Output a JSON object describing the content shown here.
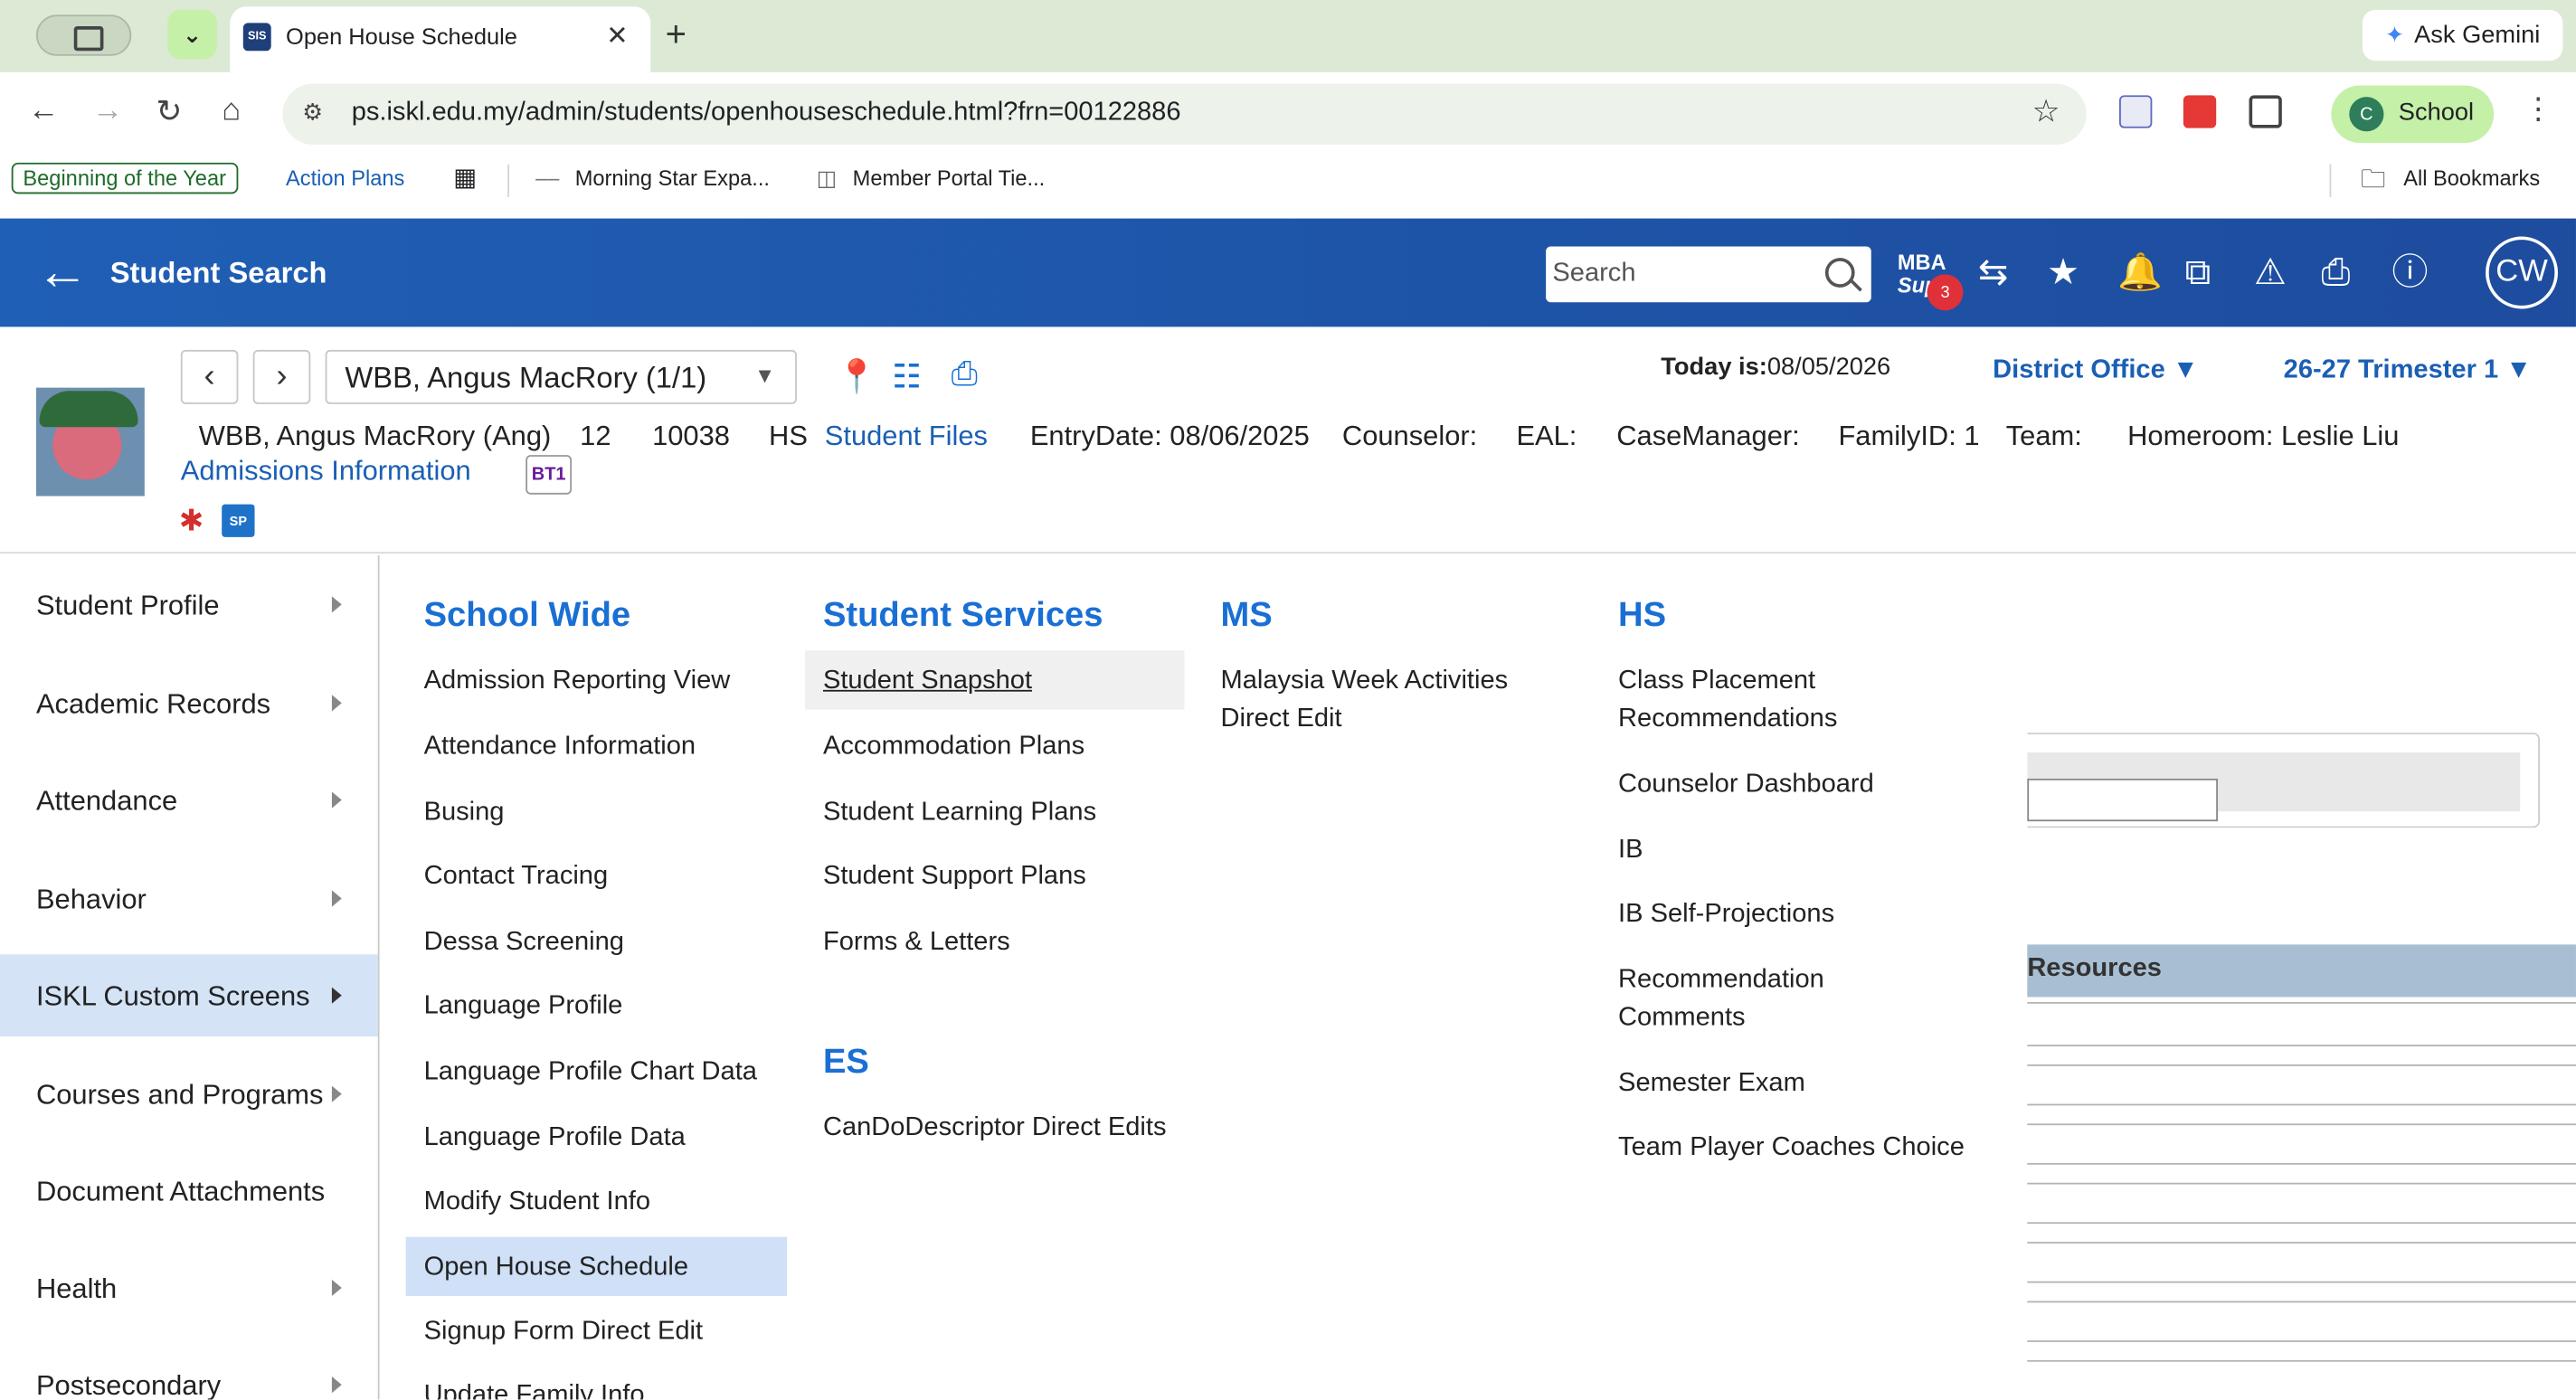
{
  "browser": {
    "tab_title": "Open House Schedule",
    "tab_favicon": "SIS",
    "ask_gemini": "Ask Gemini",
    "url": "ps.iskl.edu.my/admin/students/openhouseschedule.html?frn=00122886",
    "profile_initial": "C",
    "profile_name": "School",
    "bookmarks": [
      "Beginning of the Year",
      "Action Plans",
      "Morning Star Expa...",
      "Member Portal Tie...",
      "All Bookmarks"
    ]
  },
  "header": {
    "title": "Student Search",
    "search_placeholder": "Search",
    "mba_line1": "MBA",
    "mba_line2": "Supp",
    "mba_badge": "3",
    "user_initials": "CW"
  },
  "student": {
    "selector_value": "WBB, Angus MacRory  (1/1)",
    "today_label": "Today is:",
    "today_value": "08/05/2026",
    "district": "District Office",
    "term": "26-27 Trimester 1",
    "name": "WBB, Angus MacRory (Ang)",
    "grade": "12",
    "id": "10038",
    "school": "HS",
    "student_files": "Student Files",
    "entry_date": "EntryDate: 08/06/2025",
    "counselor": "Counselor:",
    "eal": "EAL:",
    "case_manager": "CaseManager:",
    "family_id": "FamilyID: 1",
    "team": "Team:",
    "homeroom": "Homeroom: Leslie Liu",
    "admissions": "Admissions Information",
    "bt1": "BT1",
    "sp": "SP"
  },
  "sidemenu": {
    "items": [
      {
        "label": "Student Profile",
        "submenu": true
      },
      {
        "label": "Academic Records",
        "submenu": true
      },
      {
        "label": "Attendance",
        "submenu": true
      },
      {
        "label": "Behavior",
        "submenu": true
      },
      {
        "label": "ISKL Custom Screens",
        "submenu": true
      },
      {
        "label": "Courses and Programs",
        "submenu": true
      },
      {
        "label": "Document Attachments",
        "submenu": false
      },
      {
        "label": "Health",
        "submenu": true
      },
      {
        "label": "Postsecondary",
        "submenu": true
      }
    ]
  },
  "megamenu": {
    "school_wide": {
      "heading": "School Wide",
      "items": [
        "Admission Reporting View",
        "Attendance Information",
        "Busing",
        "Contact Tracing",
        "Dessa Screening",
        "Language Profile",
        "Language Profile Chart Data",
        "Language Profile Data",
        "Modify Student Info",
        "Open House Schedule",
        "Signup Form Direct Edit",
        "Update Family Info"
      ]
    },
    "student_services": {
      "heading": "Student Services",
      "items": [
        "Student Snapshot",
        "Accommodation Plans",
        "Student Learning Plans",
        "Student Support Plans",
        "Forms & Letters"
      ]
    },
    "es": {
      "heading": "ES",
      "items": [
        "CanDoDescriptor Direct Edits"
      ]
    },
    "ms": {
      "heading": "MS",
      "items": [
        "Malaysia Week Activities",
        "Direct Edit"
      ]
    },
    "hs": {
      "heading": "HS",
      "items": [
        "Class Placement",
        "Recommendations",
        "Counselor Dashboard",
        "IB",
        "IB Self-Projections",
        "Recommendation",
        "Comments",
        "Semester Exam",
        "Team Player Coaches Choice"
      ]
    }
  },
  "background": {
    "resources": "Resources"
  }
}
